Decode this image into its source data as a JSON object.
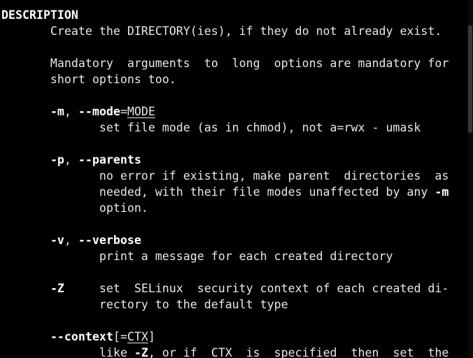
{
  "man": {
    "heading": "DESCRIPTION",
    "intro": "       Create the DIRECTORY(ies), if they do not already exist.",
    "mandatory_1": "       Mandatory  arguments  to  long  options are mandatory for",
    "mandatory_2": "       short options too.",
    "opt_m": {
      "indent": "       ",
      "short": "-m",
      "sep": ", ",
      "long": "--mode",
      "eq": "=",
      "arg": "MODE",
      "desc": "              set file mode (as in chmod), not a=rwx - umask"
    },
    "opt_p": {
      "indent": "       ",
      "short": "-p",
      "sep": ", ",
      "long": "--parents",
      "desc_1": "              no error if existing, make parent  directories  as",
      "desc_2": "              needed, with their file modes unaffected by any ",
      "desc_2_ref": "-m",
      "desc_3": "              option."
    },
    "opt_v": {
      "indent": "       ",
      "short": "-v",
      "sep": ", ",
      "long": "--verbose",
      "desc": "              print a message for each created directory"
    },
    "opt_Z": {
      "indent": "       ",
      "short": "-Z",
      "gap": "     ",
      "desc_1": "set  SELinux  security context of each created di-",
      "desc_2": "              rectory to the default type"
    },
    "opt_context": {
      "indent": "       ",
      "long": "--context",
      "open": "[=",
      "arg": "CTX",
      "close": "]",
      "desc_pre": "              like ",
      "desc_ref": "-Z",
      "desc_post": ", or if  CTX  is  specified  then  set  the"
    }
  },
  "scrollbar": {
    "position_fraction": 0.1,
    "visible_fraction": 0.3
  }
}
